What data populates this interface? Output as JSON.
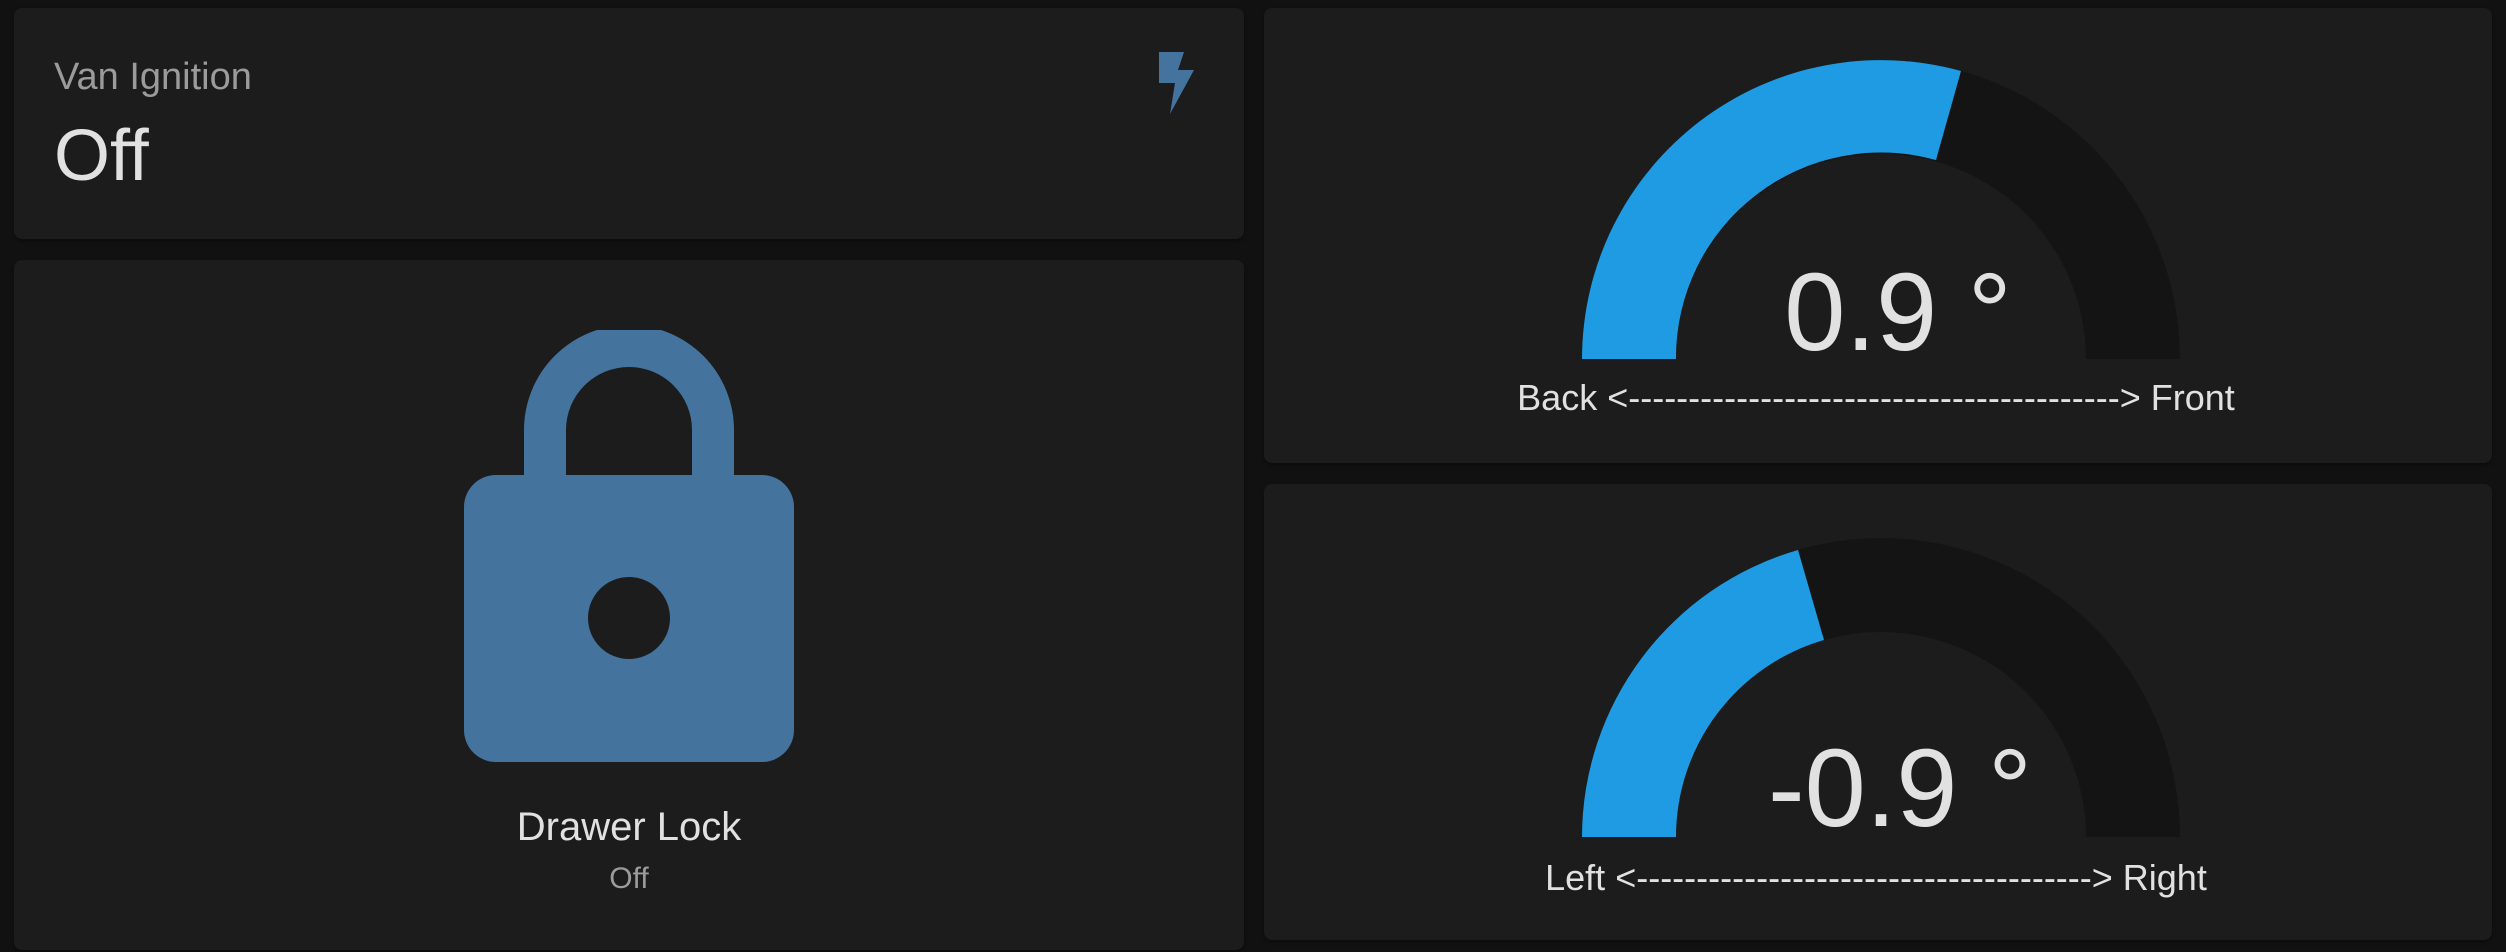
{
  "ignition": {
    "name": "Van Ignition",
    "state": "Off",
    "icon": "flash-icon",
    "icon_color": "#44739e"
  },
  "drawer_lock": {
    "name": "Drawer Lock",
    "state": "Off",
    "icon": "lock-icon",
    "icon_color": "#44739e"
  },
  "gauges": [
    {
      "value_text": "0.9 °",
      "value": 0.9,
      "fill_fraction": 0.55,
      "label": "Back <-----------------------------------------> Front",
      "fill_color": "#1e9be2",
      "track_color": "#141414"
    },
    {
      "value_text": "-0.9 °",
      "value": -0.9,
      "fill_fraction": 0.45,
      "label": "Left <--------------------------------------> Right",
      "fill_color": "#1e9be2",
      "track_color": "#141414"
    }
  ]
}
